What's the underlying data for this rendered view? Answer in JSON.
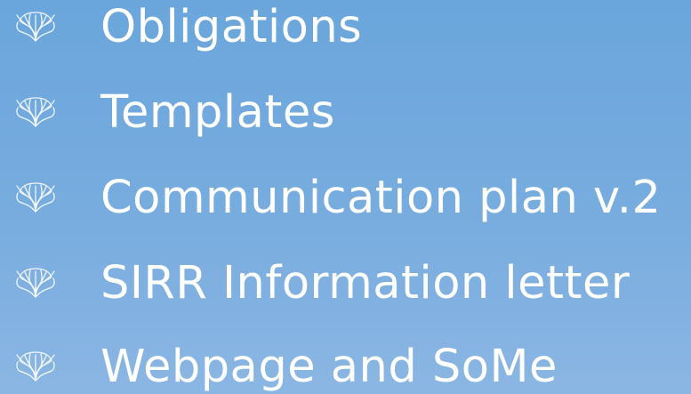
{
  "slide": {
    "items": [
      {
        "label": "Obligations",
        "icon": "coral-icon"
      },
      {
        "label": "Templates",
        "icon": "coral-icon"
      },
      {
        "label": "Communication plan v.2",
        "icon": "coral-icon"
      },
      {
        "label": "SIRR Information letter",
        "icon": "coral-icon"
      },
      {
        "label": "Webpage and SoMe",
        "icon": "coral-icon"
      }
    ]
  },
  "colors": {
    "background_top": "#6aa6dc",
    "background_bottom": "#8bb6e3",
    "text": "#ffffff"
  }
}
